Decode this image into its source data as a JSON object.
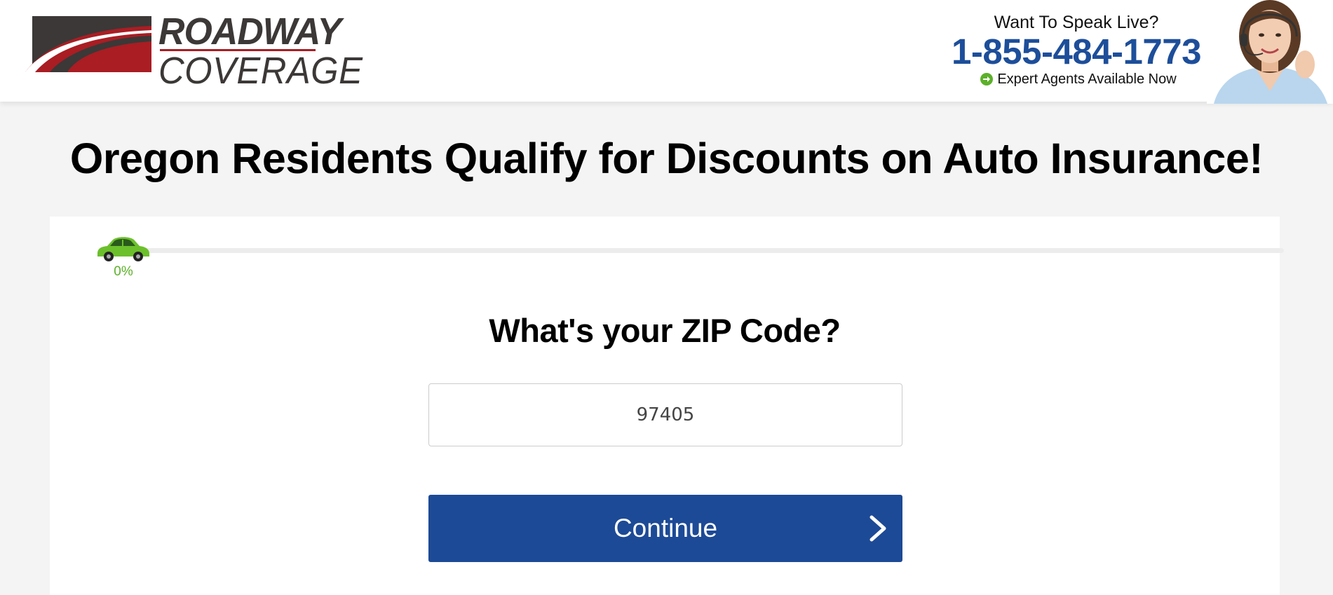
{
  "brand": {
    "name_line1": "ROADWAY",
    "name_line2": "COVERAGE",
    "colors": {
      "dark_gray": "#3b3837",
      "red": "#a91d23",
      "blue": "#1d4e9a",
      "green": "#5cb02a"
    }
  },
  "contact": {
    "prompt": "Want To Speak Live?",
    "phone": "1-855-484-1773",
    "availability": "Expert Agents Available Now",
    "availability_icon": "arrow-right-circle-icon"
  },
  "headline": "Oregon Residents Qualify for Discounts on Auto Insurance!",
  "progress": {
    "percent_label": "0%",
    "value": 0,
    "icon": "car-icon"
  },
  "form": {
    "question": "What's your ZIP Code?",
    "zip_value": "97405",
    "continue_label": "Continue",
    "continue_icon": "chevron-right-icon",
    "button_color": "#1d4a96"
  }
}
